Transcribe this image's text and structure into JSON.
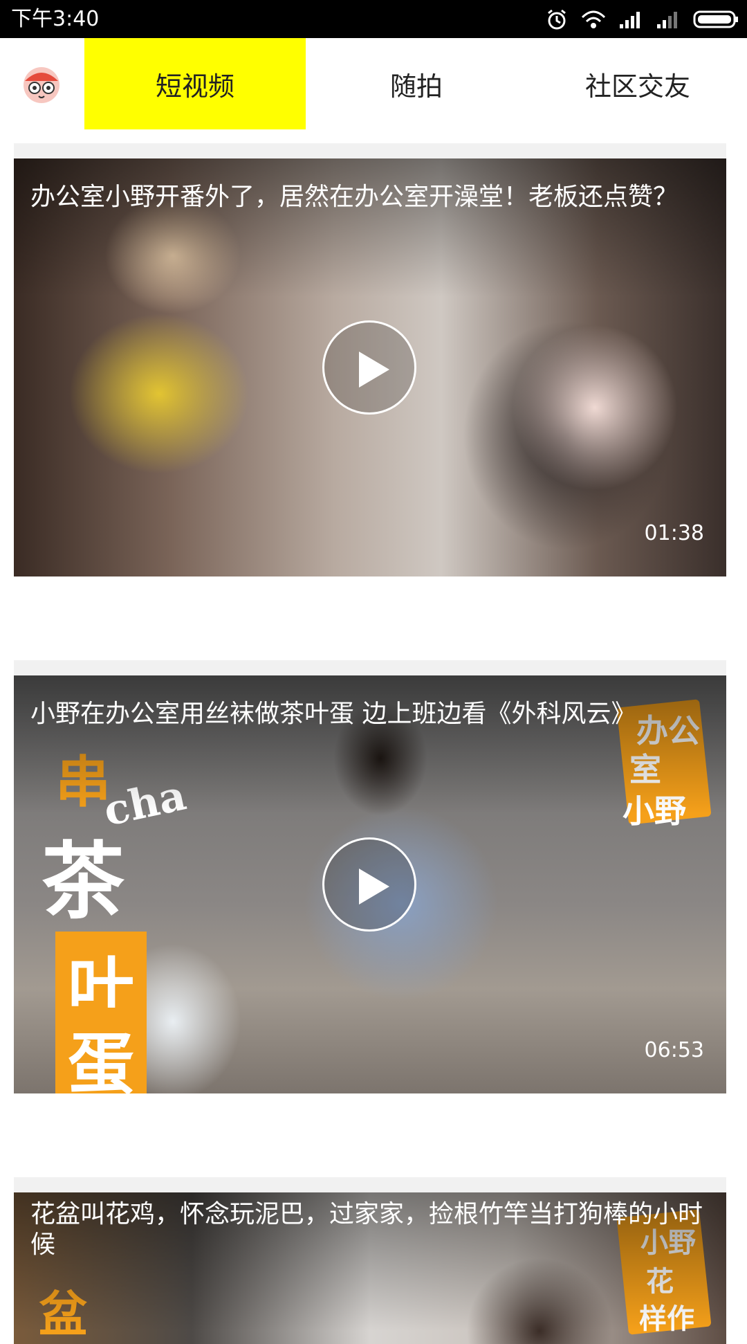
{
  "status_bar": {
    "time": "下午3:40",
    "icons": [
      "alarm-icon",
      "wifi-icon",
      "signal-icon",
      "signal-weak-icon",
      "battery-icon"
    ]
  },
  "nav": {
    "tabs": [
      {
        "label": "短视频",
        "active": true
      },
      {
        "label": "随拍",
        "active": false
      },
      {
        "label": "社区交友",
        "active": false
      }
    ],
    "active_color": "#ffff00"
  },
  "feed": [
    {
      "title": "办公室小野开番外了，居然在办公室开澡堂！老板还点赞？",
      "duration": "01:38"
    },
    {
      "title": "小野在办公室用丝袜做茶叶蛋 边上班边看《外科风云》",
      "duration": "06:53",
      "overlay_text": [
        "串",
        "cha",
        "茶",
        "叶",
        "蛋",
        "办公",
        "室",
        "小野"
      ]
    },
    {
      "title": "花盆叫花鸡，怀念玩泥巴，过家家，捡根竹竿当打狗棒的小时候",
      "overlay_text": [
        "盆",
        "小野",
        "花",
        "样作"
      ]
    }
  ]
}
